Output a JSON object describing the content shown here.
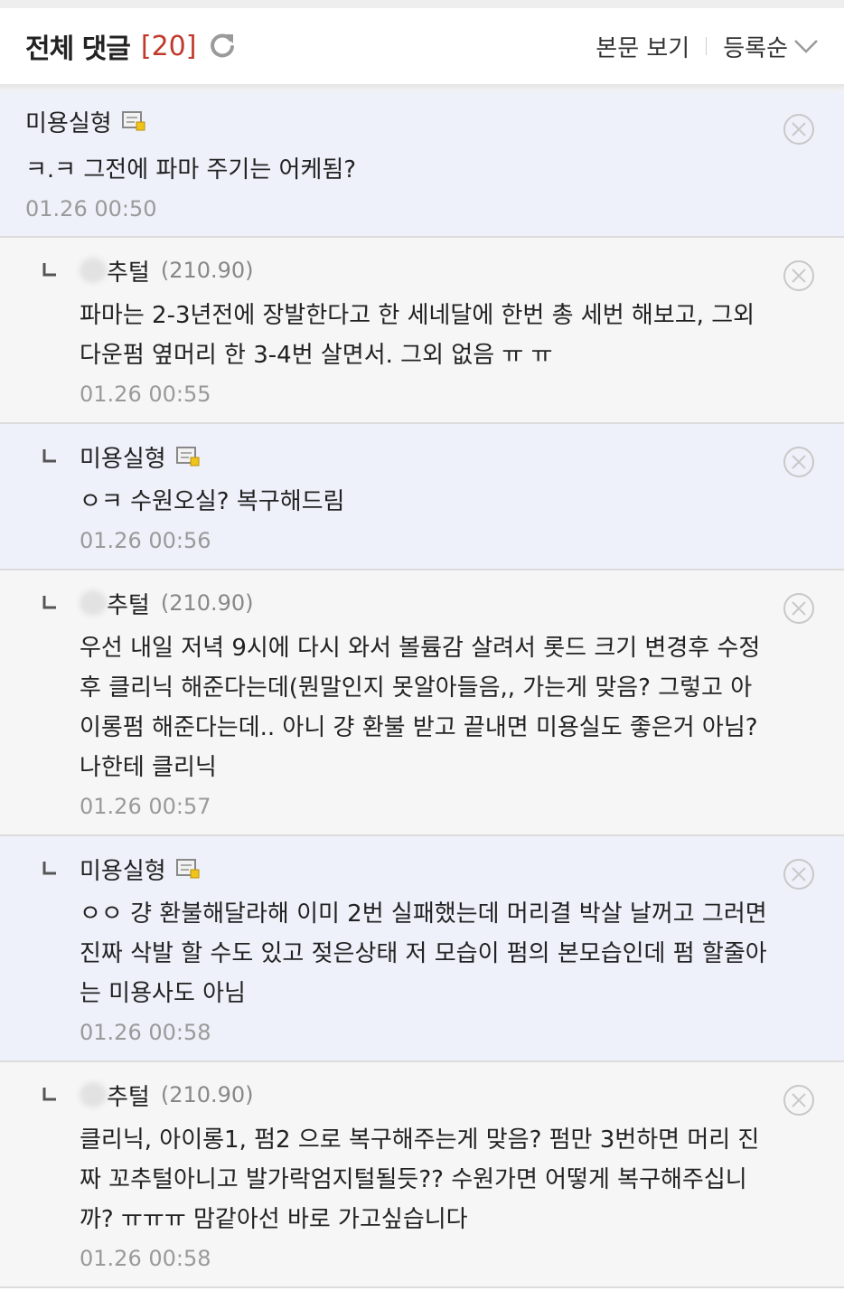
{
  "header": {
    "title": "전체 댓글",
    "count": "[20]",
    "view_body": "본문 보기",
    "sort": "등록순"
  },
  "colors": {
    "op_background": "#eef1fa",
    "reply_background": "#f6f6f6",
    "count_red": "#c0392b",
    "date_gray": "#9a9a9a"
  },
  "comments": [
    {
      "author": "미용실형",
      "ip": "",
      "lines": [
        "ㅋ.ㅋ 그전에 파마 주기는 어케됨?"
      ],
      "date": "01.26 00:50"
    },
    {
      "author": "추털",
      "ip": "(210.90)",
      "lines": [
        "파마는 2-3년전에 장발한다고 한 세네달에 한번 총 세번 해보고, 그외",
        "다운펌 옆머리 한 3-4번 살면서. 그외 없음 ㅠ ㅠ"
      ],
      "date": "01.26 00:55"
    },
    {
      "author": "미용실형",
      "ip": "",
      "lines": [
        "ㅇㅋ 수원오실? 복구해드림"
      ],
      "date": "01.26 00:56"
    },
    {
      "author": "추털",
      "ip": "(210.90)",
      "lines": [
        "우선 내일 저녁 9시에 다시 와서 볼륨감 살려서 롯드 크기 변경후 수정",
        "후 클리닉 해준다는데(뭔말인지 못알아들음,, 가는게 맞음? 그렇고 아",
        "이롱펌 해준다는데.. 아니 걍 환불 받고 끝내면 미용실도 좋은거 아님?",
        "나한테 클리닉"
      ],
      "date": "01.26 00:57"
    },
    {
      "author": "미용실형",
      "ip": "",
      "lines": [
        "ㅇㅇ 걍 환불해달라해 이미 2번 실패했는데 머리결 박살 날꺼고 그러면",
        "진짜 삭발 할 수도 있고 젖은상태 저 모습이 펌의 본모습인데 펌 할줄아",
        "는 미용사도 아님"
      ],
      "date": "01.26 00:58"
    },
    {
      "author": "추털",
      "ip": "(210.90)",
      "lines": [
        "클리닉, 아이롱1, 펌2 으로 복구해주는게 맞음? 펌만 3번하면 머리 진",
        "짜 꼬추털아니고 발가락엄지털될듯?? 수원가면 어떻게 복구해주십니",
        "까? ㅠㅠㅠ 맘같아선 바로 가고싶습니다"
      ],
      "date": "01.26 00:58"
    }
  ]
}
